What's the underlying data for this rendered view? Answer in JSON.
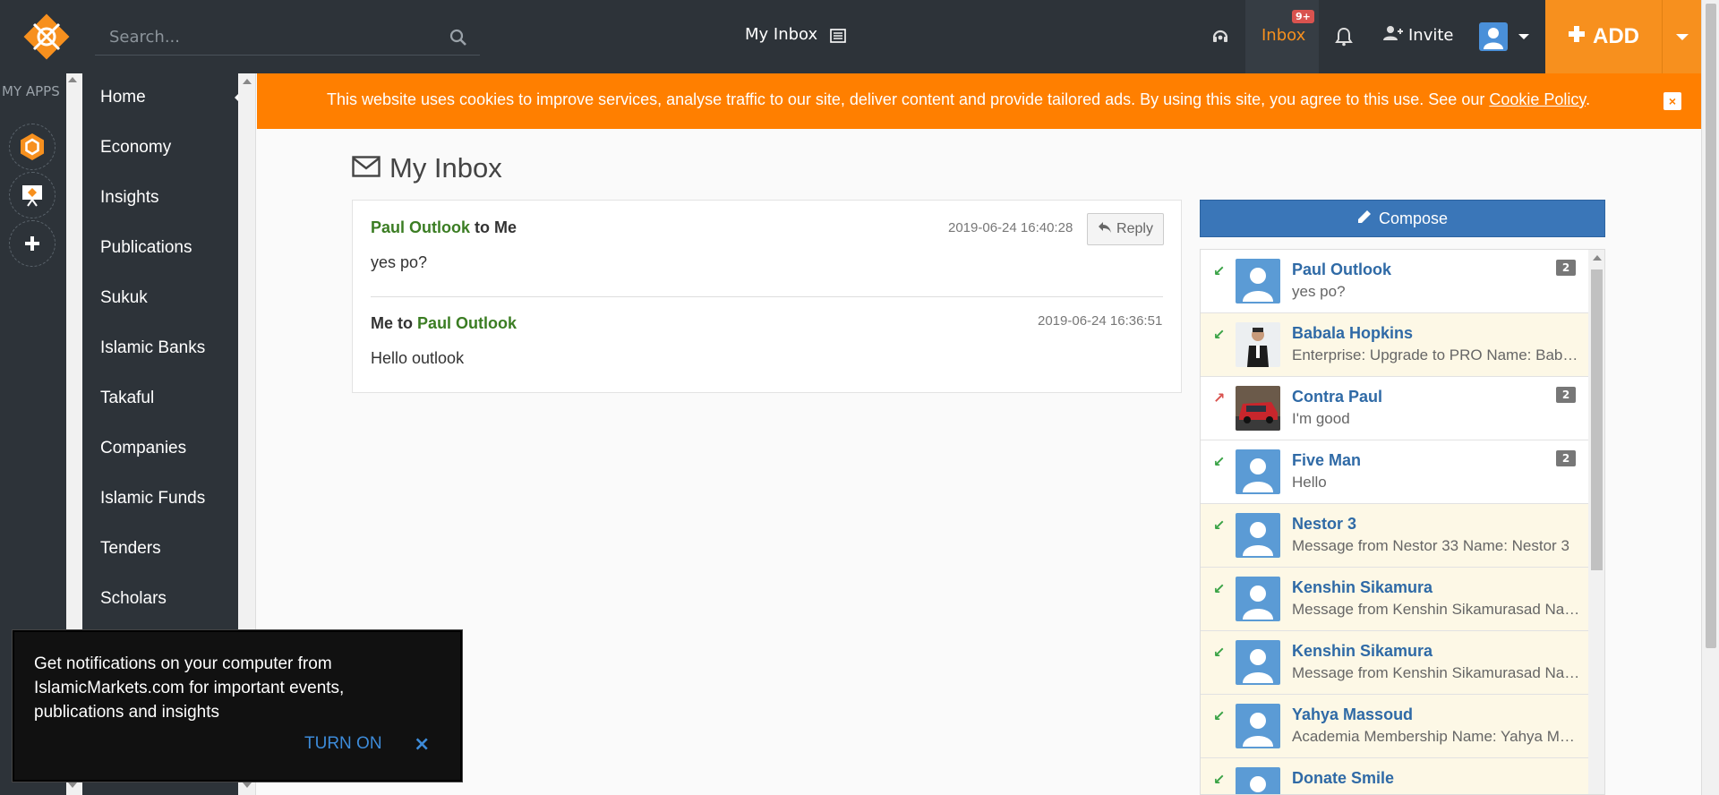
{
  "header": {
    "search_placeholder": "Search...",
    "page_title": "My Inbox",
    "inbox_label": "Inbox",
    "inbox_badge": "9+",
    "invite_label": "Invite",
    "add_label": "ADD"
  },
  "apps": {
    "title": "MY APPS"
  },
  "sidebar": {
    "items": [
      {
        "label": "Home"
      },
      {
        "label": "Economy"
      },
      {
        "label": "Insights"
      },
      {
        "label": "Publications"
      },
      {
        "label": "Sukuk"
      },
      {
        "label": "Islamic Banks"
      },
      {
        "label": "Takaful"
      },
      {
        "label": "Companies"
      },
      {
        "label": "Islamic Funds"
      },
      {
        "label": "Tenders"
      },
      {
        "label": "Scholars"
      }
    ]
  },
  "cookie": {
    "text": "This website uses cookies to improve services, analyse traffic to our site, deliver content and provide tailored ads. By using this site, you agree to this use. See our",
    "link": "Cookie Policy",
    "end": ".",
    "close": "×"
  },
  "main": {
    "title": "My Inbox",
    "reply_label": "Reply",
    "messages": [
      {
        "from": "Paul Outlook",
        "connector": "to",
        "to": "Me",
        "date": "2019-06-24 16:40:28",
        "body": "yes po?"
      },
      {
        "from": "Me",
        "connector": "to",
        "to": "Paul Outlook",
        "date": "2019-06-24 16:36:51",
        "body": "Hello outlook"
      }
    ]
  },
  "panel": {
    "compose_label": "Compose",
    "conversations": [
      {
        "name": "Paul Outlook",
        "preview": "yes po?",
        "count": "2",
        "direction": "in",
        "unread": false,
        "avatar": "default"
      },
      {
        "name": "Babala Hopkins",
        "preview": "Enterprise: Upgrade to PRO Name: Babala Hopkins",
        "count": "",
        "direction": "in",
        "unread": true,
        "avatar": "person-photo"
      },
      {
        "name": "Contra Paul",
        "preview": "I'm good",
        "count": "2",
        "direction": "out",
        "unread": false,
        "avatar": "car-photo"
      },
      {
        "name": "Five Man",
        "preview": "Hello",
        "count": "2",
        "direction": "in",
        "unread": false,
        "avatar": "default"
      },
      {
        "name": "Nestor 3",
        "preview": "Message from Nestor 33 Name: Nestor 3",
        "count": "",
        "direction": "in",
        "unread": true,
        "avatar": "default"
      },
      {
        "name": "Kenshin Sikamura",
        "preview": "Message from Kenshin Sikamurasad Name: Kenshin",
        "count": "",
        "direction": "in",
        "unread": true,
        "avatar": "default"
      },
      {
        "name": "Kenshin Sikamura",
        "preview": "Message from Kenshin Sikamurasad Name: Kenshin",
        "count": "",
        "direction": "in",
        "unread": true,
        "avatar": "default"
      },
      {
        "name": "Yahya Massoud",
        "preview": "Academia Membership Name: Yahya Massoud",
        "count": "",
        "direction": "in",
        "unread": true,
        "avatar": "default"
      },
      {
        "name": "Donate Smile",
        "preview": "",
        "count": "",
        "direction": "in",
        "unread": true,
        "avatar": "default"
      }
    ]
  },
  "notification": {
    "text": "Get notifications on your computer from IslamicMarkets.com for important events, publications and insights",
    "turn_on": "TURN ON",
    "close": "×"
  },
  "colors": {
    "topbar": "#2d3339",
    "accent": "#f7901e",
    "cookie_banner": "#ff7f00",
    "link_green": "#3b7d23",
    "name_blue": "#2f6aa6",
    "compose_blue": "#3a76b8",
    "in_arrow": "#3aa346",
    "out_arrow": "#d9534f"
  }
}
